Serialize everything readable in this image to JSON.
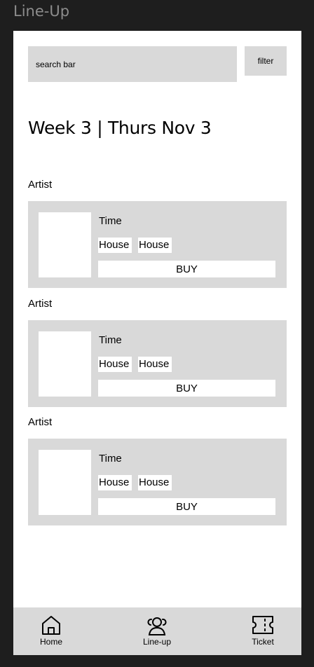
{
  "frame": {
    "title": "Line-Up"
  },
  "search": {
    "placeholder": "search bar",
    "filter_label": "filter"
  },
  "heading": "Week 3 | Thurs Nov 3",
  "artists": [
    {
      "artist": "Artist",
      "time": "Time",
      "tags": [
        "House",
        "House"
      ],
      "buy_label": "BUY"
    },
    {
      "artist": "Artist",
      "time": "Time",
      "tags": [
        "House",
        "House"
      ],
      "buy_label": "BUY"
    },
    {
      "artist": "Artist",
      "time": "Time",
      "tags": [
        "House",
        "House"
      ],
      "buy_label": "BUY"
    }
  ],
  "tabs": [
    {
      "label": "Home",
      "icon": "home-icon"
    },
    {
      "label": "Line-up",
      "icon": "people-icon"
    },
    {
      "label": "Ticket",
      "icon": "ticket-icon"
    }
  ]
}
